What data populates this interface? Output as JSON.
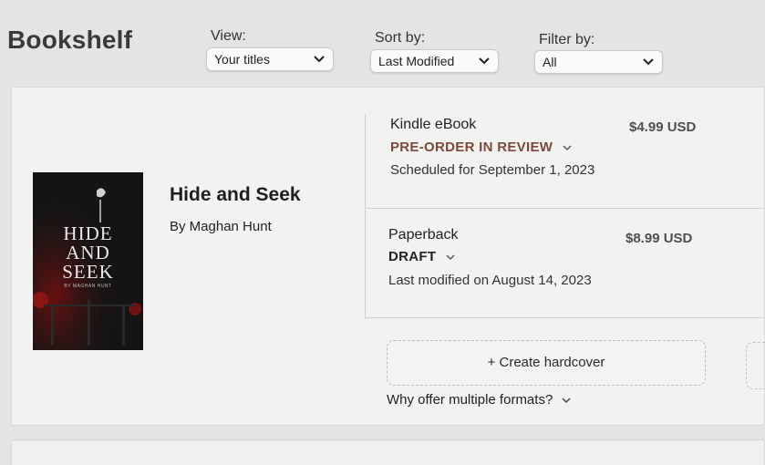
{
  "header": {
    "title": "Bookshelf",
    "view": {
      "label": "View:",
      "value": "Your titles"
    },
    "sort": {
      "label": "Sort by:",
      "value": "Last Modified"
    },
    "filter": {
      "label": "Filter by:",
      "value": "All"
    }
  },
  "book": {
    "title": "Hide and Seek",
    "author": "By Maghan Hunt",
    "cover": {
      "line1": "HIDE",
      "line2": "AND",
      "line3": "SEEK",
      "sub": "BY MAGHAN HUNT"
    }
  },
  "formats": [
    {
      "name": "Kindle eBook",
      "price": "$4.99 USD",
      "status": "PRE-ORDER IN REVIEW",
      "status_color": "#7a4a3a",
      "detail": "Scheduled for September 1, 2023"
    },
    {
      "name": "Paperback",
      "price": "$8.99 USD",
      "status": "DRAFT",
      "status_color": "#222222",
      "detail": "Last modified on August 14, 2023"
    }
  ],
  "create_hardcover": "+ Create hardcover",
  "why_formats": "Why offer multiple formats?"
}
